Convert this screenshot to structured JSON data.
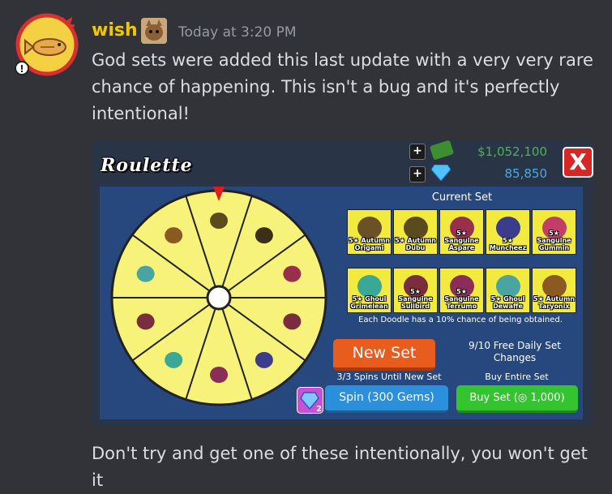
{
  "message": {
    "username": "wish",
    "timestamp": "Today at 3:20 PM",
    "text_main": "God sets were added this last update with a very very rare chance of happening. This isn't a bug and it's perfectly intentional!",
    "text_followup": "Don't try and get one of these intentionally, you won't get it"
  },
  "game": {
    "title": "Roulette",
    "money": "$1,052,100",
    "gems": "85,850",
    "plus_label": "+",
    "close_label": "X",
    "current_set_title": "Current Set",
    "cards_row1": [
      {
        "label": "5★ Autumn Origami",
        "color": "#6b5226"
      },
      {
        "label": "5★ Autumn Dubu",
        "color": "#5a4a1d"
      },
      {
        "label": "5★ Sanguine Aspare",
        "color": "#9a2f4c"
      },
      {
        "label": "5★ Muncheez",
        "color": "#3b3d8c"
      },
      {
        "label": "5★ Sanguine Gummin",
        "color": "#c13f66"
      }
    ],
    "cards_row2": [
      {
        "label": "5★ Ghoul Grimelean",
        "color": "#3aa894"
      },
      {
        "label": "5★ Sanguine Sullbird",
        "color": "#7a2d3d"
      },
      {
        "label": "5★ Sanguine Terrumo",
        "color": "#8a2e58"
      },
      {
        "label": "5★ Ghoul Dewaffe",
        "color": "#4aa4a0"
      },
      {
        "label": "5★ Autumn Taryonix",
        "color": "#8a5a22"
      }
    ],
    "chance_text": "Each Doodle has a 10% chance of being obtained.",
    "new_set_button": "New Set",
    "free_daily": "9/10 Free Daily Set Changes",
    "spins_until": "3/3 Spins Until New Set",
    "buy_entire": "Buy Entire Set",
    "spin_button": "Spin (300 Gems)",
    "buy_button": "Buy Set (◎ 1,000)",
    "gem_badge_count": "2",
    "wheel_colors": [
      "#5a4a1d",
      "#3d2e18",
      "#9a2f4c",
      "#7a2d3d",
      "#3b3d8c",
      "#8a2e58",
      "#3aa894",
      "#7a2d3d",
      "#4aa4a0",
      "#8a5a22"
    ]
  }
}
